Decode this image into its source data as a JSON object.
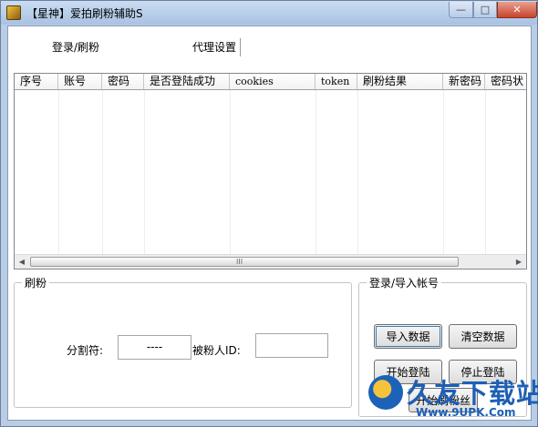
{
  "window": {
    "title": "【星神】爱拍刷粉辅助S",
    "minimize_glyph": "—",
    "maximize_glyph": "□",
    "close_glyph": "✕"
  },
  "tabs": [
    {
      "label": "登录/刷粉"
    },
    {
      "label": "代理设置"
    }
  ],
  "table": {
    "columns": [
      "序号",
      "账号",
      "密码",
      "是否登陆成功",
      "cookies",
      "token",
      "刷粉结果",
      "新密码",
      "密码状"
    ],
    "rows": [],
    "scroll_grip": "III",
    "scroll_left": "◀",
    "scroll_right": "▶"
  },
  "fans_group": {
    "title": "刷粉",
    "separator_label": "分割符:",
    "separator_value": "----",
    "target_id_label": "被粉人ID:",
    "target_id_value": ""
  },
  "login_group": {
    "title": "登录/导入帐号",
    "import_button": "导入数据",
    "clear_button": "清空数据",
    "start_login_button": "开始登陆",
    "stop_login_button": "停止登陆",
    "start_fans_button": "开始刷粉丝"
  },
  "watermark": {
    "name": "久友下载站",
    "url": "Www.9UPK.Com"
  },
  "colors": {
    "frame": "#b9cde6",
    "close_button": "#c8452c",
    "watermark": "#1d5fb6"
  }
}
